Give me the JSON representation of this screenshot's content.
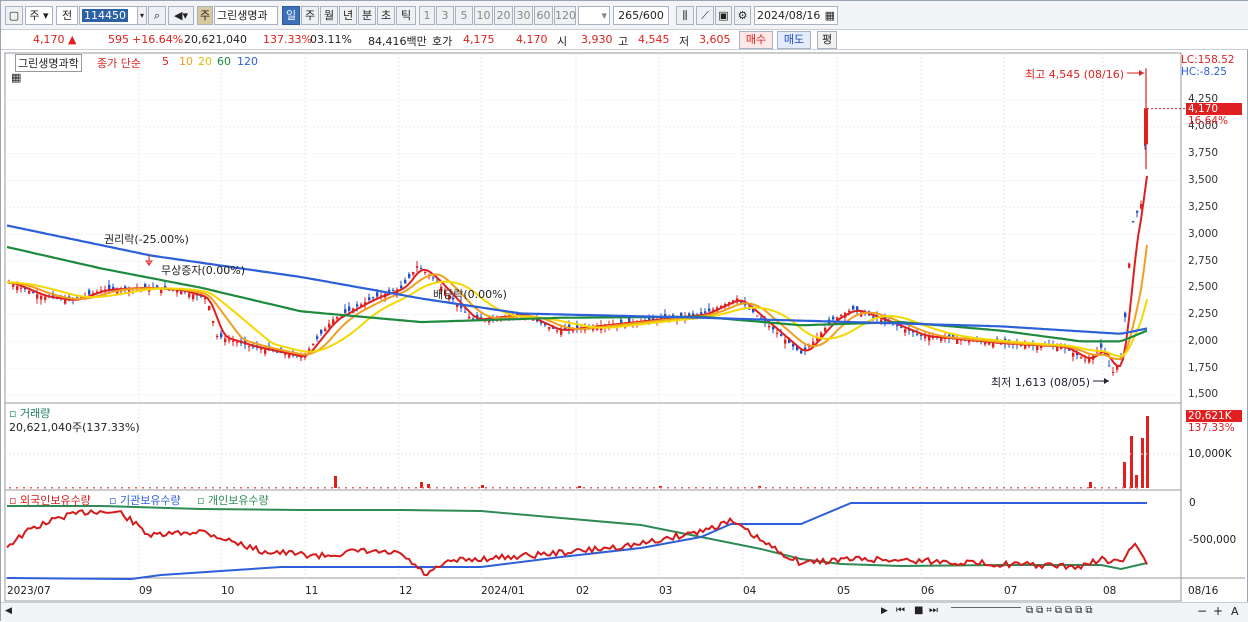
{
  "toolbar": {
    "period_main": "주",
    "prev_label": "전",
    "code": "114450",
    "search_icon": "search-icon",
    "speaker_icon": "speaker-icon",
    "stock_tag": "주",
    "stock_name": "그린생명과",
    "periods": [
      "일",
      "주",
      "월",
      "년",
      "분",
      "초",
      "틱"
    ],
    "active_period": "일",
    "intervals": [
      "1",
      "3",
      "5",
      "10",
      "20",
      "30",
      "60",
      "120"
    ],
    "count": "265",
    "count_total": "/600",
    "date": "2024/08/16"
  },
  "quote": {
    "price": "4,170",
    "change": "595",
    "change_pct": "+16.64%",
    "volume": "20,621,040",
    "volume_pct": "137.33%",
    "turnover_pct": "03.11%",
    "amount": "84,416백만",
    "bid_label": "호가",
    "bid": "4,175",
    "ask": "4,170",
    "open_label": "시",
    "open": "3,930",
    "high_label": "고",
    "high": "4,545",
    "low_label": "저",
    "low": "3,605",
    "buy_label": "매수",
    "sell_label": "매도",
    "eval_label": "평"
  },
  "legend": {
    "name": "그린생명과학",
    "series_label": "종가 단순",
    "ma": [
      {
        "label": "5",
        "color": "#e01f1f"
      },
      {
        "label": "10",
        "color": "#f0a020"
      },
      {
        "label": "20",
        "color": "#f5d800"
      },
      {
        "label": "60",
        "color": "#1e8a3e"
      },
      {
        "label": "120",
        "color": "#2c5fd8"
      }
    ]
  },
  "price_axis": {
    "lc": "LC:158.52",
    "hc": "HC:-8.25",
    "ticks": [
      "4,250",
      "4,000",
      "3,750",
      "3,500",
      "3,250",
      "3,000",
      "2,750",
      "2,500",
      "2,250",
      "2,000",
      "1,750",
      "1,500"
    ],
    "current": "4,170",
    "current_pct": "16.64%"
  },
  "annotations": {
    "high": "최고 4,545 (08/16)",
    "low": "최저 1,613 (08/05)",
    "rights": "권리락(-25.00%)",
    "bonus": "무상증자(0.00%)",
    "dividend": "배당락(0.00%)"
  },
  "volume_panel": {
    "title": "거래량",
    "value": "20,621,040주(137.33%)",
    "tick": "10,000K",
    "current": "20,621K",
    "current_pct": "137.33%"
  },
  "holdings_panel": {
    "series": [
      {
        "label": "외국인보유수량",
        "color": "#d41c1c"
      },
      {
        "label": "기관보유수량",
        "color": "#2c5fd8"
      },
      {
        "label": "개인보유수량",
        "color": "#2f8a55"
      }
    ],
    "ticks": [
      "0",
      "-500,000"
    ]
  },
  "x_axis": [
    "2023/07",
    "09",
    "10",
    "11",
    "12",
    "2024/01",
    "02",
    "03",
    "04",
    "05",
    "06",
    "07",
    "08",
    "08/16"
  ],
  "chart_data": {
    "type": "line",
    "title": "그린생명과학",
    "x": [
      "2023/07",
      "09",
      "10",
      "11",
      "12",
      "2024/01",
      "02",
      "03",
      "04",
      "05",
      "06",
      "07",
      "08",
      "08/16"
    ],
    "series": [
      {
        "name": "종가",
        "values": [
          2550,
          2450,
          2400,
          1850,
          2500,
          2200,
          2150,
          2250,
          2350,
          2200,
          2000,
          1900,
          1700,
          4170
        ]
      },
      {
        "name": "120",
        "values": [
          3000,
          2800,
          2650,
          2500,
          2350,
          2250,
          2240,
          2230,
          2200,
          2180,
          2150,
          2100,
          2070,
          2100
        ]
      }
    ],
    "ylim": [
      1500,
      4545
    ]
  }
}
